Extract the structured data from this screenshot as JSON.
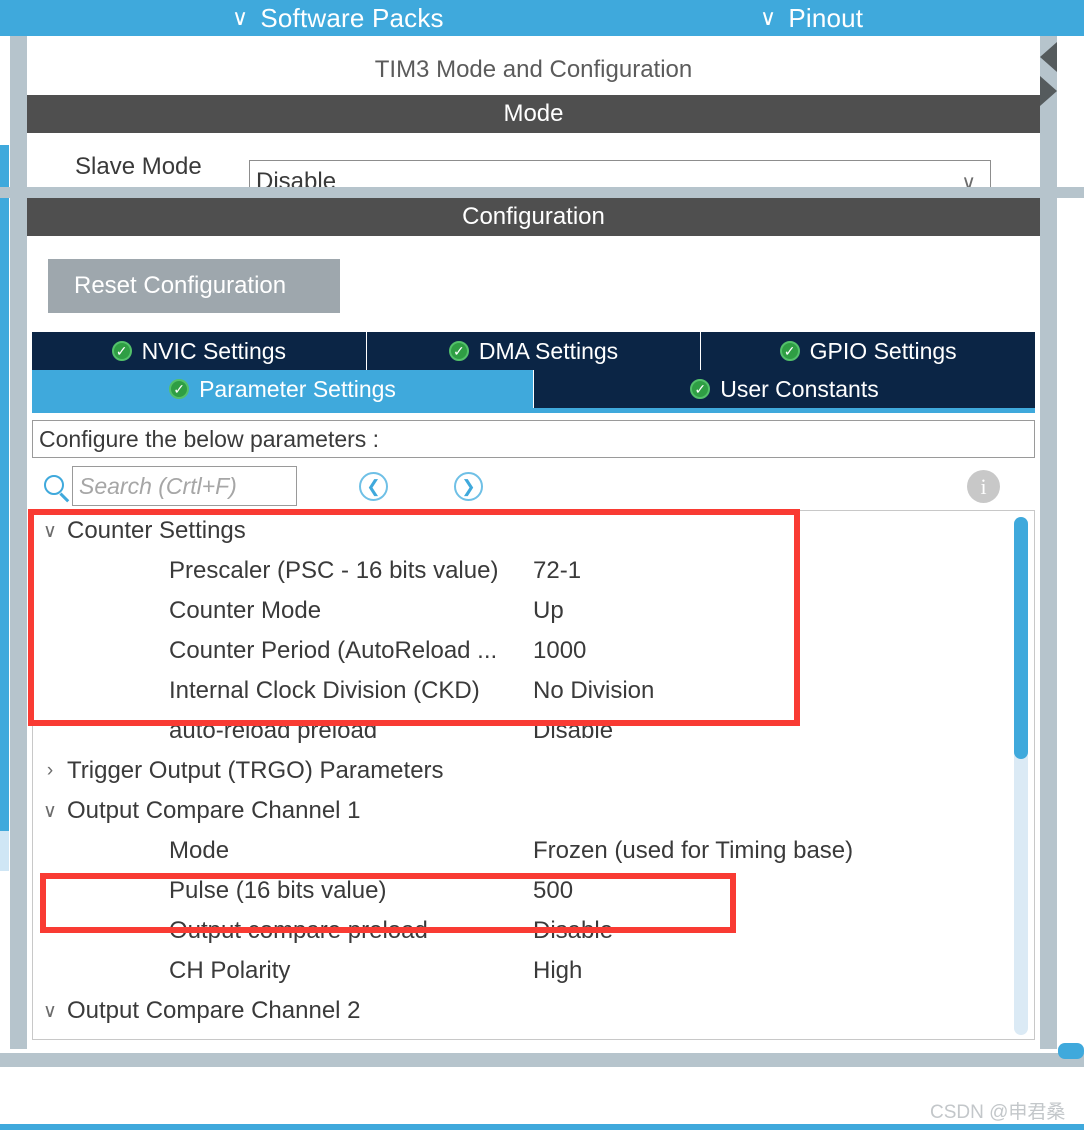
{
  "topbar": {
    "items": [
      {
        "label": "Software Packs",
        "icon": "chevron-down-icon"
      },
      {
        "label": "Pinout",
        "icon": "chevron-down-icon"
      }
    ]
  },
  "mode_panel": {
    "title": "TIM3 Mode and Configuration",
    "section_header": "Mode",
    "slave_mode_label": "Slave Mode",
    "slave_mode_value": "Disable",
    "caret_icon": "chevron-down-icon"
  },
  "config_panel": {
    "section_header": "Configuration",
    "reset_button": "Reset Configuration",
    "tabs_row1": [
      {
        "label": "NVIC Settings",
        "status_icon": "check-circle-icon",
        "active": false
      },
      {
        "label": "DMA Settings",
        "status_icon": "check-circle-icon",
        "active": false
      },
      {
        "label": "GPIO Settings",
        "status_icon": "check-circle-icon",
        "active": false
      }
    ],
    "tabs_row2": [
      {
        "label": "Parameter Settings",
        "status_icon": "check-circle-icon",
        "active": true
      },
      {
        "label": "User Constants",
        "status_icon": "check-circle-icon",
        "active": false
      }
    ],
    "hint": "Configure the below parameters :",
    "search": {
      "placeholder": "Search (Crtl+F)",
      "value": "",
      "icon": "search-icon",
      "prev_icon": "chevron-left-circle-icon",
      "next_icon": "chevron-right-circle-icon",
      "info_icon": "info-circle-icon",
      "info_glyph": "i"
    }
  },
  "parameters": [
    {
      "kind": "group",
      "name": "Counter Settings",
      "expanded": true,
      "chev": "∨"
    },
    {
      "kind": "leaf",
      "name": "Prescaler (PSC - 16 bits value)",
      "value": "72-1"
    },
    {
      "kind": "leaf",
      "name": "Counter Mode",
      "value": "Up"
    },
    {
      "kind": "leaf",
      "name": "Counter Period (AutoReload ...",
      "value": "1000"
    },
    {
      "kind": "leaf",
      "name": "Internal Clock Division (CKD)",
      "value": "No Division"
    },
    {
      "kind": "leaf",
      "name": "auto-reload preload",
      "value": "Disable"
    },
    {
      "kind": "group",
      "name": "Trigger Output (TRGO) Parameters",
      "expanded": false,
      "chev": "›"
    },
    {
      "kind": "group",
      "name": "Output Compare Channel 1",
      "expanded": true,
      "chev": "∨"
    },
    {
      "kind": "leaf",
      "name": "Mode",
      "value": "Frozen (used for Timing base)"
    },
    {
      "kind": "leaf",
      "name": "Pulse (16 bits value)",
      "value": "500"
    },
    {
      "kind": "leaf",
      "name": "Output compare preload",
      "value": "Disable"
    },
    {
      "kind": "leaf",
      "name": "CH Polarity",
      "value": "High"
    },
    {
      "kind": "group",
      "name": "Output Compare Channel 2",
      "expanded": true,
      "chev": "∨"
    }
  ],
  "annotations": [
    {
      "id": "counter-settings-highlight",
      "color": "#f93b33"
    },
    {
      "id": "pulse-highlight",
      "color": "#f93b33"
    }
  ],
  "watermark": "CSDN @申君桑",
  "colors": {
    "accent_blue": "#3FA9DC",
    "tab_navy": "#0b2545",
    "dark_header": "#4f4f4f",
    "chrome_gray": "#b6c4cc",
    "annotation_red": "#f93b33",
    "status_green": "#2f9e44"
  }
}
